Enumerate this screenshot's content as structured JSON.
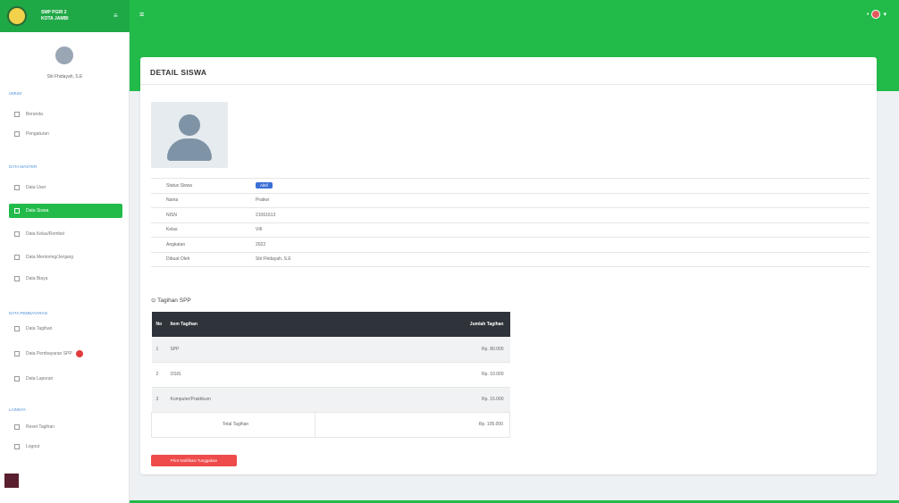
{
  "app": {
    "name_line1": "SMP PGRI 2",
    "name_line2": "KOTA JAMBI"
  },
  "sidebar": {
    "user_name": "Siti Fhidayah, S.E",
    "sections": [
      {
        "label": "UMUM"
      },
      {
        "label": "DATA MASTER"
      },
      {
        "label": "DATA PEMBAYARAN"
      },
      {
        "label": "LAINNYA"
      }
    ],
    "items": [
      {
        "label": "Beranda",
        "icon": "home-icon"
      },
      {
        "label": "Pengaturan",
        "icon": "settings-icon"
      },
      {
        "label": "Data User",
        "icon": "users-icon"
      },
      {
        "label": "Data Siswa",
        "icon": "student-icon"
      },
      {
        "label": "Data Kelas/Rombel",
        "icon": "class-icon"
      },
      {
        "label": "Data Mentoring/Jenjang",
        "icon": "layers-icon"
      },
      {
        "label": "Data Biaya",
        "icon": "money-icon"
      },
      {
        "label": "Data Tagihan",
        "icon": "bill-icon"
      },
      {
        "label": "Data Pembayaran SPP",
        "icon": "payment-icon"
      },
      {
        "label": "Data Laporan",
        "icon": "report-icon"
      },
      {
        "label": "Reset Tagihan",
        "icon": "reset-icon"
      },
      {
        "label": "Logout",
        "icon": "logout-icon"
      }
    ]
  },
  "main": {
    "title": "DETAIL SISWA",
    "info": [
      {
        "key": "Status Siswa",
        "value": "Aktif"
      },
      {
        "key": "Nama",
        "value": "Pratiwi"
      },
      {
        "key": "NISN",
        "value": "21061613"
      },
      {
        "key": "Kelas",
        "value": "VIII"
      },
      {
        "key": "Angkatan",
        "value": "2022"
      },
      {
        "key": "Dibuat Oleh",
        "value": "Siti Fhidayah, S.E"
      }
    ],
    "tagihan_title": "Tagihan SPP",
    "bill_headers": {
      "no": "No",
      "item": "Item Tagihan",
      "amount": "Jumlah Tagihan"
    },
    "bills": [
      {
        "no": "1",
        "item": "SPP",
        "amount": "Rp. 80.000"
      },
      {
        "no": "2",
        "item": "OSIS",
        "amount": "Rp. 10.000"
      },
      {
        "no": "3",
        "item": "Komputer/Praktikum",
        "amount": "Rp. 15.000"
      }
    ],
    "total_label": "Total Tagihan",
    "total_amount": "Rp. 105.000",
    "print_button": "Print Notifikasi Tunggakan"
  }
}
